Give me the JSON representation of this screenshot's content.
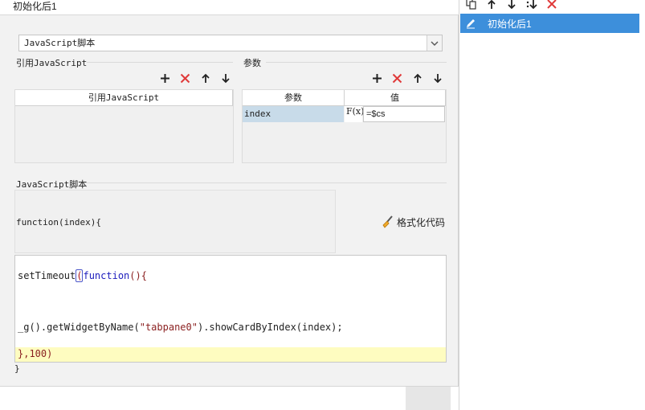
{
  "dialog": {
    "title": "初始化后1",
    "script_type": {
      "selected": "JavaScript脚本"
    },
    "ref_js": {
      "label": "引用JavaScript",
      "column_header": "引用JavaScript"
    },
    "params": {
      "label": "参数",
      "columns": [
        "参数",
        "值"
      ],
      "rows": [
        {
          "name": "index",
          "fx": "F(x)",
          "value": "=$cs"
        }
      ]
    },
    "script": {
      "label": "JavaScript脚本",
      "header_code": "function(index){",
      "format_label": "格式化代码",
      "code_lines": {
        "l1_a": "setTimeout",
        "l1_paren": "(",
        "l1_kw": "function",
        "l1_b": "(){",
        "l2_a": "_g",
        "l2_b": "().getWidgetByName(",
        "l2_str": "\"tabpane0\"",
        "l2_c": ").showCardByIndex(index);",
        "l3": "},100)"
      },
      "footer_code": "}"
    }
  },
  "right_panel": {
    "items": [
      {
        "label": "初始化后1",
        "selected": true
      }
    ]
  },
  "colors": {
    "accent": "#3d8fdb",
    "delete": "#e03a3a",
    "param_row": "#c8dbe9",
    "current_line": "#fefcc0"
  }
}
